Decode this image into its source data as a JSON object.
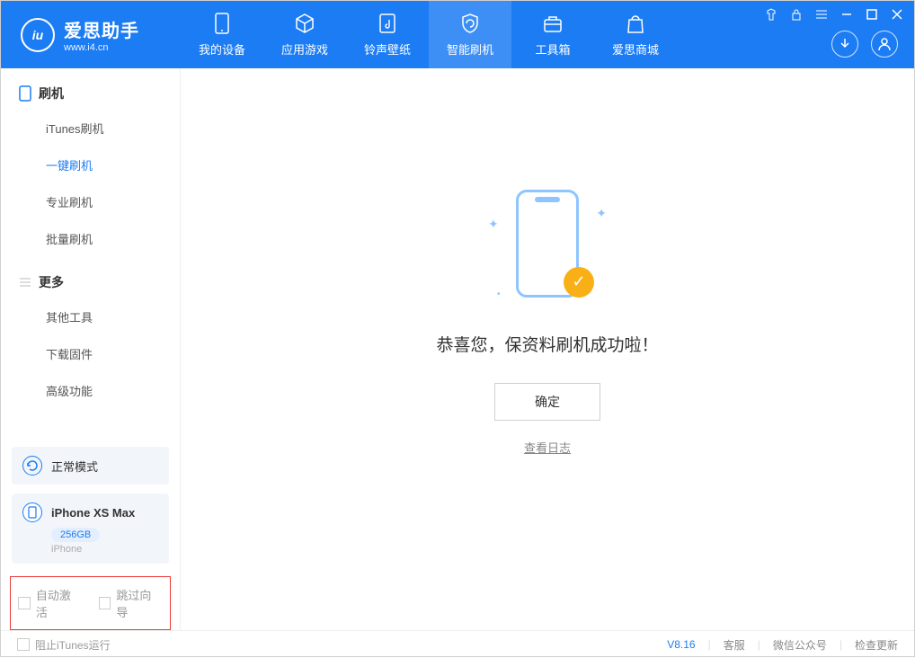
{
  "logo": {
    "title": "爱思助手",
    "subtitle": "www.i4.cn"
  },
  "nav": [
    {
      "label": "我的设备"
    },
    {
      "label": "应用游戏"
    },
    {
      "label": "铃声壁纸"
    },
    {
      "label": "智能刷机"
    },
    {
      "label": "工具箱"
    },
    {
      "label": "爱思商城"
    }
  ],
  "sidebar": {
    "section1_title": "刷机",
    "items1": [
      {
        "label": "iTunes刷机"
      },
      {
        "label": "一键刷机"
      },
      {
        "label": "专业刷机"
      },
      {
        "label": "批量刷机"
      }
    ],
    "section2_title": "更多",
    "items2": [
      {
        "label": "其他工具"
      },
      {
        "label": "下载固件"
      },
      {
        "label": "高级功能"
      }
    ]
  },
  "mode": {
    "label": "正常模式"
  },
  "device": {
    "name": "iPhone XS Max",
    "storage": "256GB",
    "type": "iPhone"
  },
  "checkboxes": {
    "auto_activate": "自动激活",
    "skip_guide": "跳过向导"
  },
  "main": {
    "success_message": "恭喜您，保资料刷机成功啦！",
    "ok_button": "确定",
    "view_log": "查看日志"
  },
  "footer": {
    "block_itunes": "阻止iTunes运行",
    "version": "V8.16",
    "support": "客服",
    "wechat": "微信公众号",
    "update": "检查更新"
  }
}
